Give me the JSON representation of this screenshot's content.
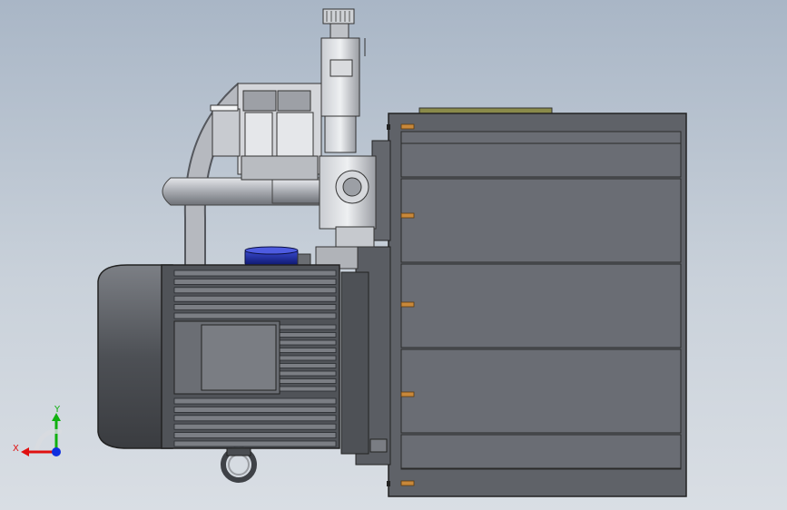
{
  "viewport": {
    "background_top": "#a9b6c6",
    "background_bottom": "#d9dee4"
  },
  "triad": {
    "x_label": "X",
    "y_label": "Y",
    "x_color": "#e01010",
    "y_color": "#10b010",
    "z_color": "#1030e0"
  },
  "model": {
    "tank_color": "#5f6268",
    "tank_panel_color": "#6d7077",
    "motor_color": "#55585d",
    "bolt_color": "#c8883a",
    "cap_color": "#1b2aa8",
    "pipe_color": "#b9bcc2"
  }
}
